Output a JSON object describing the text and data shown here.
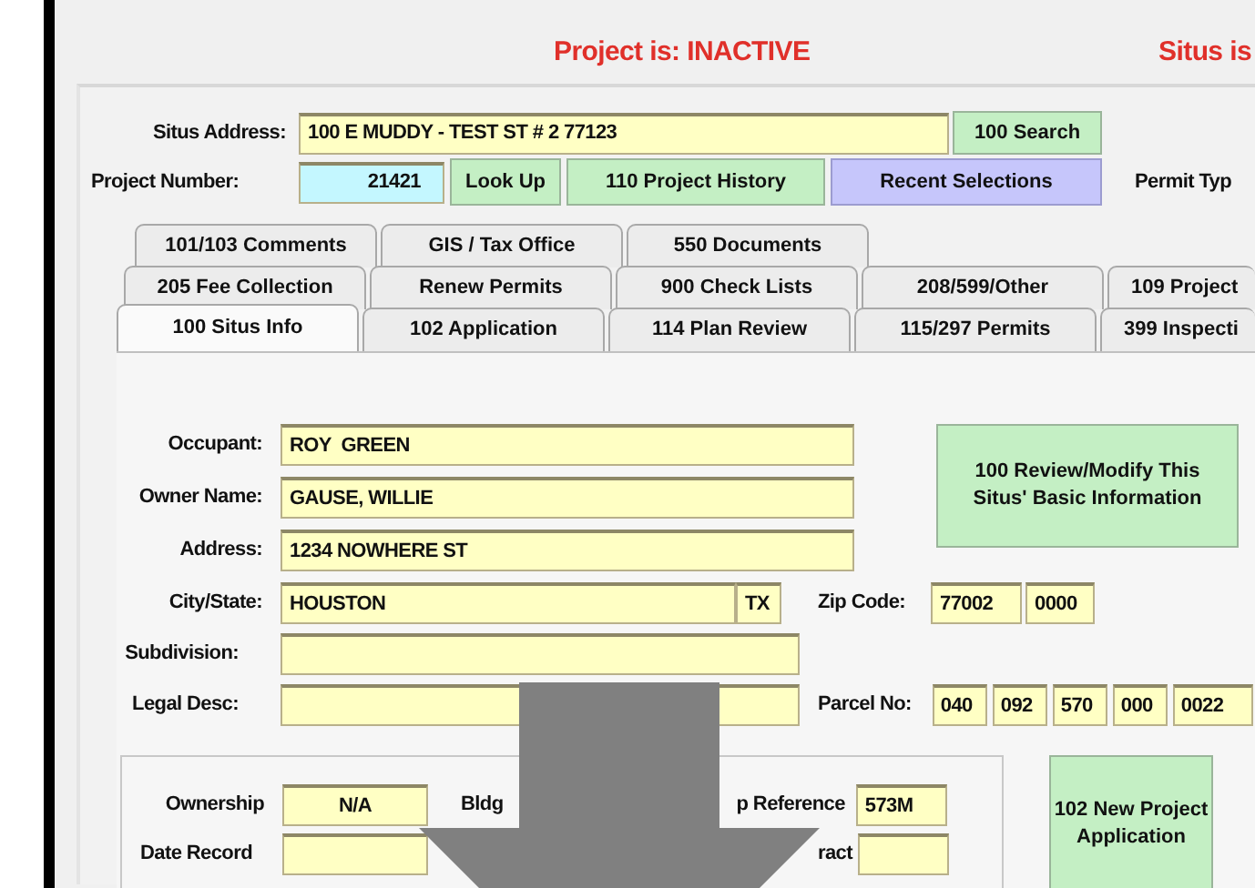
{
  "header": {
    "project_status": "Project is: INACTIVE",
    "situs_status": "Situs is"
  },
  "search": {
    "situs_label": "Situs Address:",
    "situs_value": "100 E MUDDY - TEST ST # 2 77123",
    "search_button": "100 Search",
    "project_label": "Project Number:",
    "project_value": "21421",
    "lookup_button": "Look Up",
    "history_button": "110 Project History",
    "recent_button": "Recent Selections",
    "permit_label": "Permit Typ"
  },
  "tab_rows": [
    {
      "tabs": [
        {
          "label": "101/103 Comments",
          "selected": false
        },
        {
          "label": "GIS / Tax Office",
          "selected": false
        },
        {
          "label": "550 Documents",
          "selected": false
        }
      ]
    },
    {
      "tabs": [
        {
          "label": "205 Fee Collection",
          "selected": false
        },
        {
          "label": "Renew Permits",
          "selected": false
        },
        {
          "label": "900 Check Lists",
          "selected": false
        },
        {
          "label": "208/599/Other",
          "selected": false
        },
        {
          "label": "109 Project",
          "selected": false
        }
      ]
    },
    {
      "tabs": [
        {
          "label": "100 Situs Info",
          "selected": true
        },
        {
          "label": "102 Application",
          "selected": false
        },
        {
          "label": "114 Plan Review",
          "selected": false
        },
        {
          "label": "115/297 Permits",
          "selected": false
        },
        {
          "label": "399 Inspecti",
          "selected": false
        }
      ]
    }
  ],
  "situs": {
    "fields": [
      {
        "label": "Occupant:",
        "value": "ROY  GREEN"
      },
      {
        "label": "Owner Name:",
        "value": "GAUSE, WILLIE"
      },
      {
        "label": "Address:",
        "value": "1234 NOWHERE ST"
      }
    ],
    "city_label": "City/State:",
    "city": "HOUSTON",
    "state": "TX",
    "zip_label": "Zip Code:",
    "zip": "77002",
    "zip_ext": "0000",
    "subdivision_label": "Subdivision:",
    "legal_label": "Legal Desc:",
    "parcel_label": "Parcel No:",
    "parcel_parts": [
      "040",
      "092",
      "570",
      "000",
      "0022"
    ],
    "review_button": "100 Review/Modify This Situs' Basic Information"
  },
  "details": {
    "ownership_label": "Ownership",
    "ownership_value": "N/A",
    "bldg_label": "Bldg",
    "map_ref_label": "p Reference",
    "map_ref_value": "573M",
    "date_label": "Date Record",
    "tract_label": "ract",
    "new_project_button": "102 New Project Application"
  }
}
